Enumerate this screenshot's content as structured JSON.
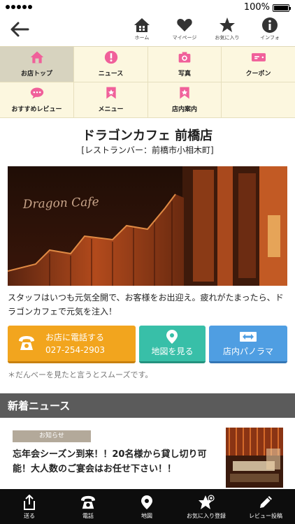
{
  "status": {
    "battery": "100%"
  },
  "header": {
    "nav": [
      {
        "label": "ホーム",
        "icon": "home-icon"
      },
      {
        "label": "マイページ",
        "icon": "heart-icon"
      },
      {
        "label": "お気に入り",
        "icon": "star-icon"
      },
      {
        "label": "インフォ",
        "icon": "info-icon"
      }
    ]
  },
  "menu": {
    "items": [
      {
        "label": "お店トップ",
        "icon": "home-icon",
        "active": true
      },
      {
        "label": "ニュース",
        "icon": "alert-icon"
      },
      {
        "label": "写真",
        "icon": "camera-icon"
      },
      {
        "label": "クーポン",
        "icon": "coupon-icon"
      },
      {
        "label": "おすすめレビュー",
        "icon": "chat-icon"
      },
      {
        "label": "メニュー",
        "icon": "bookmark-icon"
      },
      {
        "label": "店内案内",
        "icon": "bookmark-icon"
      }
    ],
    "icon_color": "#f0609a"
  },
  "shop": {
    "name": "ドラゴンカフェ 前橋店",
    "subtitle": "[レストランバー：前橋市小相木町]",
    "photo_sign": "Dragon Cafe",
    "description": "スタッフはいつも元気全開で、お客様をお出迎え。疲れがたまったら、ドラゴンカフェで元気を注入！"
  },
  "actions": {
    "call_label": "お店に電話する",
    "call_number": "027-254-2903",
    "map_label": "地図を見る",
    "panorama_label": "店内パノラマ",
    "note": "＊だんべーを見たと言うとスムーズです。"
  },
  "news": {
    "heading": "新着ニュース",
    "badge": "お知らせ",
    "text": "忘年会シーズン到来！！20名様から貸し切り可能！大人数のご宴会はお任せ下さい！！"
  },
  "tabbar": [
    {
      "label": "送る",
      "icon": "share-icon"
    },
    {
      "label": "電話",
      "icon": "phone-icon"
    },
    {
      "label": "地図",
      "icon": "map-pin-icon"
    },
    {
      "label": "お気に入り登録",
      "icon": "star-add-icon"
    },
    {
      "label": "レビュー投稿",
      "icon": "pencil-icon"
    }
  ]
}
